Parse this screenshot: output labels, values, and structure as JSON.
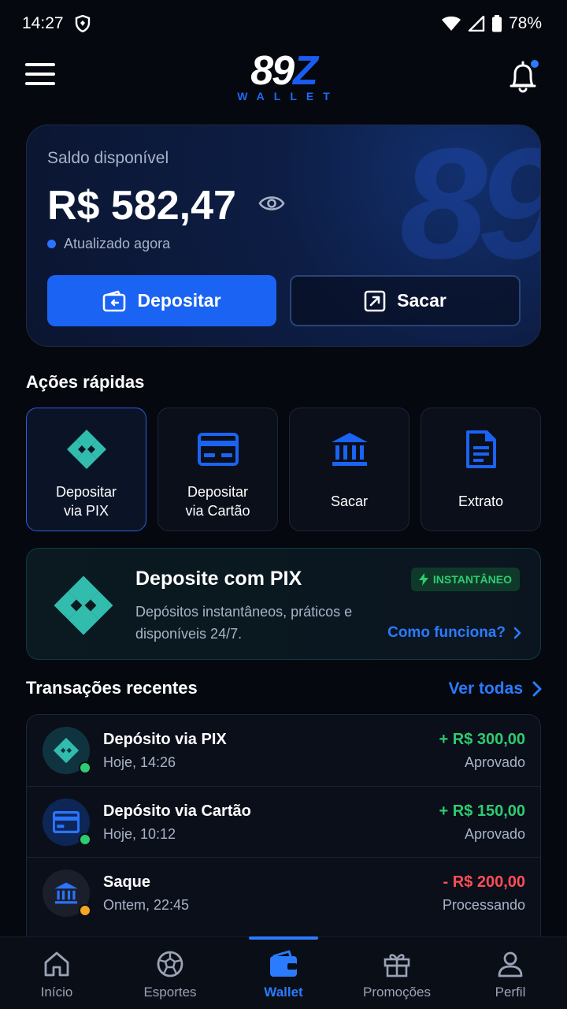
{
  "status_bar": {
    "time": "14:27",
    "battery": "78%"
  },
  "header": {
    "logo_main": "89",
    "logo_z": "Z",
    "logo_sub": "WALLET",
    "notification_dot_color": "#2a7bff"
  },
  "balance": {
    "label": "Saldo disponível",
    "value": "R$ 582,47",
    "updated": "Atualizado agora",
    "watermark": "89",
    "deposit_label": "Depositar",
    "withdraw_label": "Sacar"
  },
  "quick_actions": {
    "title": "Ações rápidas",
    "items": [
      {
        "label": "Depositar\nvia PIX",
        "icon": "pix-icon"
      },
      {
        "label": "Depositar\nvia Cartão",
        "icon": "credit-card-icon"
      },
      {
        "label": "Sacar",
        "icon": "bank-icon"
      },
      {
        "label": "Extrato",
        "icon": "document-icon"
      }
    ]
  },
  "pix_banner": {
    "title": "Deposite com PIX",
    "description": "Depósitos instantâneos, práticos e disponíveis 24/7.",
    "badge": "INSTANTÂNEO",
    "link": "Como funciona?"
  },
  "transactions": {
    "title": "Transações recentes",
    "see_all": "Ver todas",
    "items": [
      {
        "title": "Depósito via PIX",
        "date": "Hoje, 14:26",
        "amount": "+ R$ 300,00",
        "status": "Aprovado",
        "amount_color": "#2ecc71",
        "status_dot": "#2ecc71",
        "icon": "pix-icon"
      },
      {
        "title": "Depósito via Cartão",
        "date": "Hoje, 10:12",
        "amount": "+ R$ 150,00",
        "status": "Aprovado",
        "amount_color": "#2ecc71",
        "status_dot": "#2ecc71",
        "icon": "credit-card-icon"
      },
      {
        "title": "Saque",
        "date": "Ontem, 22:45",
        "amount": "- R$ 200,00",
        "status": "Processando",
        "amount_color": "#ff4d57",
        "status_dot": "#f5a623",
        "icon": "bank-icon"
      }
    ]
  },
  "bottom_nav": {
    "items": [
      {
        "label": "Início",
        "icon": "home-icon"
      },
      {
        "label": "Esportes",
        "icon": "soccer-ball-icon"
      },
      {
        "label": "Wallet",
        "icon": "wallet-icon",
        "active": true
      },
      {
        "label": "Promoções",
        "icon": "gift-icon"
      },
      {
        "label": "Perfil",
        "icon": "user-icon"
      }
    ]
  },
  "colors": {
    "accent": "#1a63f3",
    "pix": "#32bcad",
    "success": "#2ecc71",
    "danger": "#ff4d57",
    "warning": "#f5a623"
  }
}
